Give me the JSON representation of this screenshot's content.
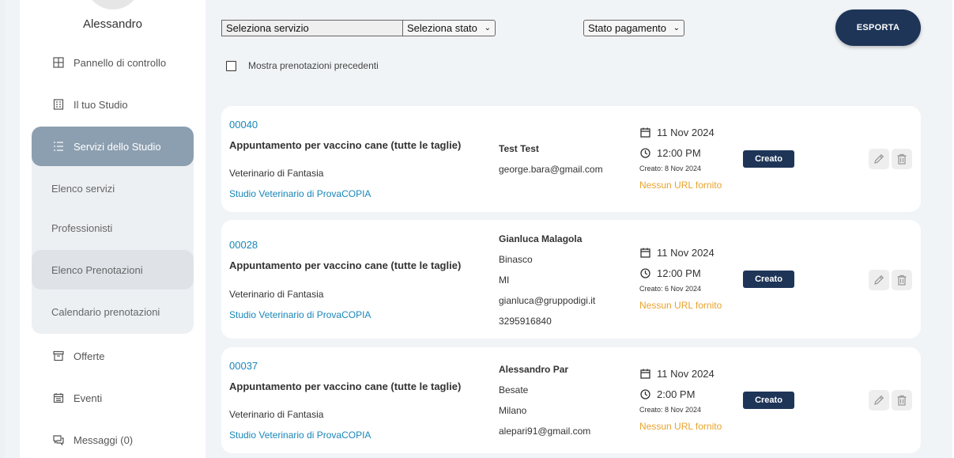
{
  "user": {
    "name": "Alessandro"
  },
  "nav": {
    "dashboard": "Pannello di controllo",
    "studio": "Il tuo Studio",
    "services": "Servizi dello Studio",
    "sub": {
      "list": "Elenco servizi",
      "pros": "Professionisti",
      "bookings": "Elenco Prenotazioni",
      "calendar": "Calendario prenotazioni"
    },
    "offers": "Offerte",
    "events": "Eventi",
    "messages": "Messaggi (0)"
  },
  "filters": {
    "service": "Seleziona servizio",
    "status": "Seleziona stato",
    "payment": "Stato pagamento",
    "export": "ESPORTA",
    "past": "Mostra prenotazioni precedenti"
  },
  "bookings": [
    {
      "code": "00040",
      "service": "Appuntamento per vaccino cane (tutte le taglie)",
      "vet": "Veterinario di Fantasia",
      "studio": "Studio Veterinario di ProvaCOPIA",
      "client": [
        "Test Test",
        "george.bara@gmail.com"
      ],
      "date": "11 Nov 2024",
      "time": "12:00 PM",
      "created": "Creato: 8 Nov 2024",
      "url": "Nessun URL fornito",
      "status": "Creato"
    },
    {
      "code": "00028",
      "service": "Appuntamento per vaccino cane (tutte le taglie)",
      "vet": "Veterinario di Fantasia",
      "studio": "Studio Veterinario di ProvaCOPIA",
      "client": [
        "Gianluca Malagola",
        "Binasco",
        "MI",
        "gianluca@gruppodigi.it",
        "3295916840"
      ],
      "date": "11 Nov 2024",
      "time": "12:00 PM",
      "created": "Creato: 6 Nov 2024",
      "url": "Nessun URL fornito",
      "status": "Creato"
    },
    {
      "code": "00037",
      "service": "Appuntamento per vaccino cane (tutte le taglie)",
      "vet": "Veterinario di Fantasia",
      "studio": "Studio Veterinario di ProvaCOPIA",
      "client": [
        "Alessandro Par",
        "Besate",
        "Milano",
        "alepari91@gmail.com"
      ],
      "date": "11 Nov 2024",
      "time": "2:00 PM",
      "created": "Creato: 8 Nov 2024",
      "url": "Nessun URL fornito",
      "status": "Creato"
    }
  ]
}
